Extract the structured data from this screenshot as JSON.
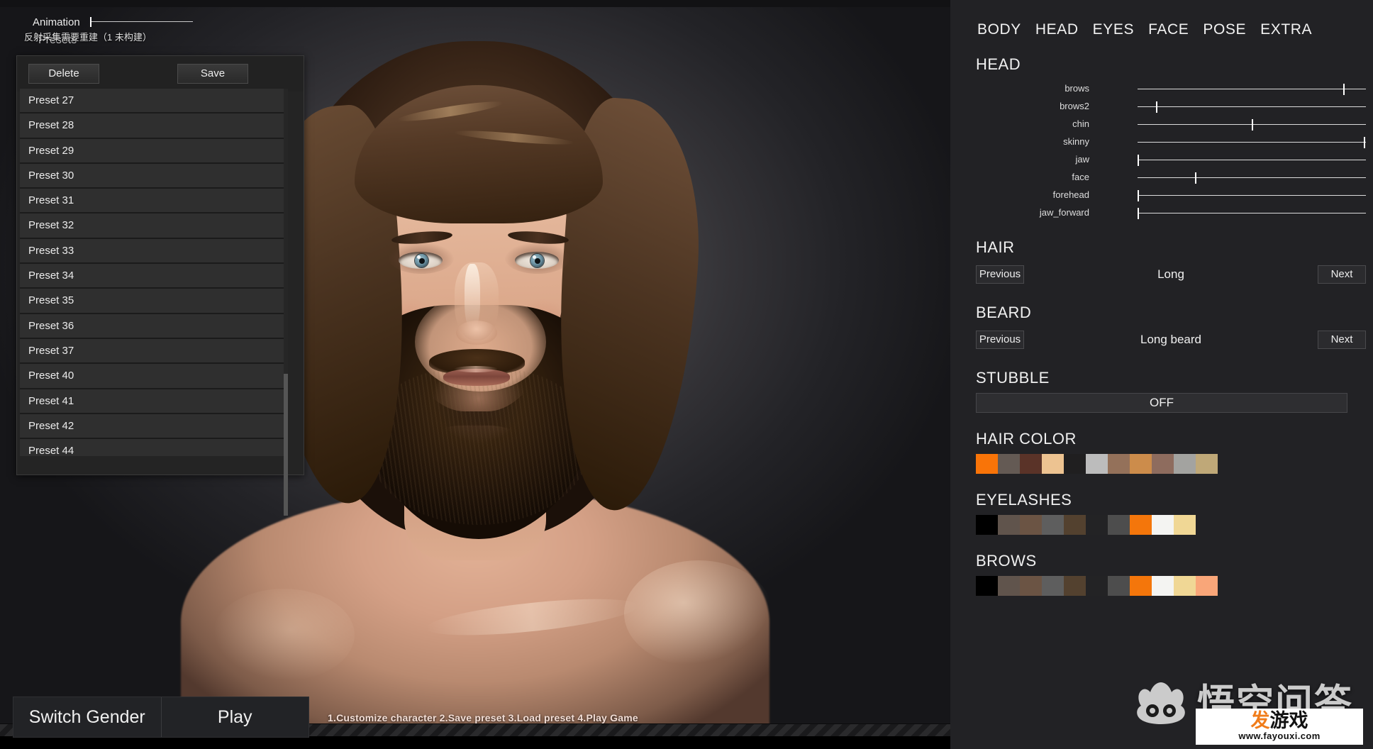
{
  "viewport": {
    "animation": {
      "label": "Animation",
      "value_pct": 0
    },
    "reflection_message": "反射采集需要重建（1 未构建）",
    "presets_title": "Presets"
  },
  "preset_panel": {
    "delete_label": "Delete",
    "save_label": "Save",
    "items": [
      "Preset 27",
      "Preset 28",
      "Preset 29",
      "Preset 30",
      "Preset 31",
      "Preset 32",
      "Preset 33",
      "Preset 34",
      "Preset 35",
      "Preset 36",
      "Preset 37",
      "Preset 40",
      "Preset 41",
      "Preset 42",
      "Preset 44"
    ]
  },
  "action_bar": {
    "switch_gender_label": "Switch Gender",
    "play_label": "Play",
    "hint": "1.Customize  character  2.Save preset  3.Load preset  4.Play Game"
  },
  "right_panel": {
    "tabs": [
      {
        "label": "BODY",
        "active": false
      },
      {
        "label": "HEAD",
        "active": true
      },
      {
        "label": "EYES",
        "active": false
      },
      {
        "label": "FACE",
        "active": false
      },
      {
        "label": "POSE",
        "active": false
      },
      {
        "label": "EXTRA",
        "active": false
      }
    ],
    "head": {
      "title": "HEAD",
      "sliders": [
        {
          "label": "brows",
          "value_pct": 90
        },
        {
          "label": "brows2",
          "value_pct": 8
        },
        {
          "label": "chin",
          "value_pct": 50
        },
        {
          "label": "skinny",
          "value_pct": 99
        },
        {
          "label": "jaw",
          "value_pct": 0
        },
        {
          "label": "face",
          "value_pct": 25
        },
        {
          "label": "forehead",
          "value_pct": 0
        },
        {
          "label": "jaw_forward",
          "value_pct": 0
        }
      ]
    },
    "hair": {
      "title": "HAIR",
      "previous_label": "Previous",
      "value": "Long",
      "next_label": "Next"
    },
    "beard": {
      "title": "BEARD",
      "previous_label": "Previous",
      "value": "Long beard",
      "next_label": "Next"
    },
    "stubble": {
      "title": "STUBBLE",
      "state": "OFF"
    },
    "hair_color": {
      "title": "HAIR COLOR",
      "swatches": [
        "#f97408",
        "#645a54",
        "#5a3328",
        "#edc391",
        "#201f20",
        "#bcbcbc",
        "#94715a",
        "#cc8c4b",
        "#8e6c5e",
        "#a3a3a0",
        "#bfa878"
      ]
    },
    "eyelashes": {
      "title": "EYELASHES",
      "swatches": [
        "#000000",
        "#60544c",
        "#6b5444",
        "#5e5e5e",
        "#53412f",
        "#232325",
        "#4d4d4d",
        "#f4760b",
        "#f4f4f2",
        "#f0d795"
      ]
    },
    "brows": {
      "title": "BROWS",
      "swatches": [
        "#000000",
        "#60544c",
        "#6b5444",
        "#5e5e5e",
        "#53412f",
        "#232325",
        "#4d4d4d",
        "#f4760b",
        "#f4f4f2",
        "#f0d795",
        "#f9a679"
      ]
    }
  },
  "watermarks": {
    "wukong_text": "悟空问答",
    "fayouxi_fa": "发",
    "fayouxi_youxi": "游戏",
    "fayouxi_url": "www.fayouxi.com"
  }
}
